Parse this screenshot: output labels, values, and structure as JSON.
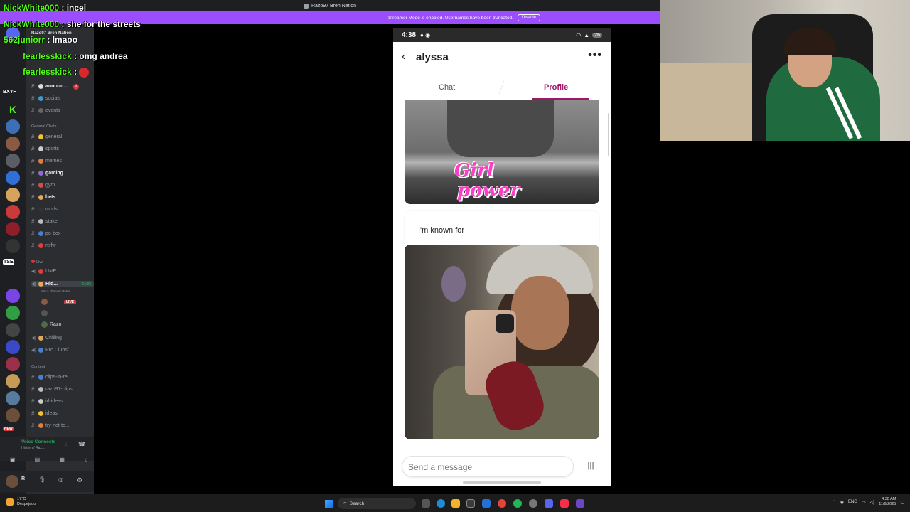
{
  "discord": {
    "window_title": "Razo97 Breh Nation",
    "streamer_banner": "Streamer Mode is enabled. Usernames have been truncated.",
    "disable_label": "Disable",
    "server_name": "Razo97 Breh Nation",
    "rail_label_1": "BXYF",
    "rail_label_2": "TSE",
    "rail_new": "NEW",
    "categories": {
      "general": "General Chats",
      "live": "Live",
      "content": "Content"
    },
    "channels_top": [
      "announ...",
      "socials",
      "events"
    ],
    "channels_general": [
      "general",
      "sports",
      "memes",
      "gaming",
      "gym",
      "bets",
      "mods",
      "stake",
      "po-box",
      "nsfw"
    ],
    "channels_live": [
      "LIVE",
      "Hid...",
      "Razo",
      "Chilling",
      "Pro Clubs/..."
    ],
    "channels_content": [
      "clips-to-re...",
      "razo97-clips",
      "irl-ideas",
      "ideas",
      "try-not-to..."
    ],
    "hid_time": "54:02",
    "channel_status": "Set a channel status",
    "live_badge": "LIVE",
    "announce_badge": "2",
    "voice_connected": "Voice Connecte",
    "voice_sub": "Hidden / Raz...",
    "user_initial": "R"
  },
  "chat_overlay": [
    {
      "user": "NickWhite000",
      "message": "incel"
    },
    {
      "user": "NickWhite000",
      "message": "she for the streets"
    },
    {
      "user": "562juniorr",
      "message": "lmaoo"
    },
    {
      "user": "fearlesskick",
      "message": "omg andrea"
    },
    {
      "user": "fearlesskick",
      "message": ""
    }
  ],
  "phone": {
    "time": "4:38",
    "battery": "26",
    "contact_name": "alyssa",
    "tabs": [
      "Chat",
      "Profile"
    ],
    "active_tab": "Profile",
    "photo1_caption_1": "Girl",
    "photo1_caption_2": "power",
    "prompt": "I'm known for",
    "message_placeholder": "Send a message",
    "accent_color": "#a0166b"
  },
  "taskbar": {
    "weather_temp": "17°C",
    "weather_desc": "Despejado",
    "search_label": "Search",
    "lang": "ENG",
    "time": "4:38 AM",
    "date": "11/6/2025"
  }
}
